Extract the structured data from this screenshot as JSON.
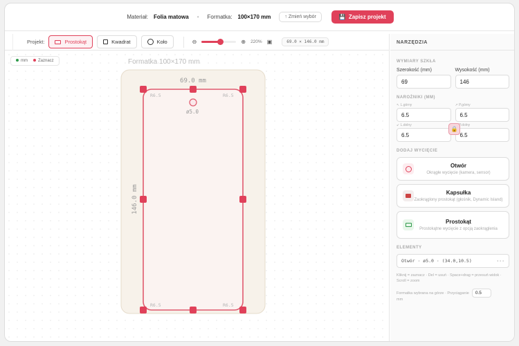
{
  "topbar": {
    "material_label": "Materiał:",
    "material_value": "Folia matowa",
    "format_label": "Formatka:",
    "format_value": "100×170 mm",
    "change_button": "↑ Zmień wybór",
    "save_button": "Zapisz projekt"
  },
  "toolbar": {
    "project_label": "Projekt:",
    "shapes": [
      {
        "label": "Prostokąt",
        "active": true
      },
      {
        "label": "Kwadrat",
        "active": false
      },
      {
        "label": "Koło",
        "active": false
      }
    ],
    "zoom_value": "220%",
    "zoom_level": 0.55,
    "dims_readout": "69.0 × 146.0 mm"
  },
  "legend": {
    "mm": "mm",
    "select": "Zaznacz"
  },
  "canvas": {
    "format_title": "Formatka 100×170 mm",
    "width_label": "69.0 mm",
    "height_label": "146.0 mm",
    "hole_label": "ø5.0",
    "corner_labels": [
      "R6.5",
      "R6.5",
      "R6.5",
      "R6.5"
    ],
    "accent": "#e0415a"
  },
  "panel": {
    "title": "NARZĘDZIA",
    "dims_section": "WYMIARY SZKŁA",
    "width_label": "Szerokość (mm)",
    "width_value": "69",
    "height_label": "Wysokość (mm)",
    "height_value": "146",
    "corners_section": "NAROŻNIKI (MM)",
    "corner_tl_label": "↖ L.górny",
    "corner_tl": "6.5",
    "corner_tr_label": "↗ P.górny",
    "corner_tr": "6.5",
    "corner_bl_label": "↙ L.dolny",
    "corner_bl": "6.5",
    "corner_br_label": "↘ P.dolny",
    "corner_br": "6.5",
    "cutout_section": "DODAJ WYCIĘCIE",
    "cutouts": [
      {
        "title": "Otwór",
        "sub": "Okrągłe wycięcie (kamera, sensor)"
      },
      {
        "title": "Kapsułka",
        "sub": "Zaokrąglony prostokąt (głośnik, Dynamic Island)"
      },
      {
        "title": "Prostokąt",
        "sub": "Prostokątne wycięcie z opcją zaokrąglenia"
      }
    ],
    "elements_section": "ELEMENTY",
    "element_selected": "Otwór · ø5.0 · (34.0,10.5)",
    "hint": "Kliknij = zaznacz · Del = usuń · Space+drag = przesuń widok · Scroll = zoom",
    "footer_text": "Formatka wybrana na górze · Przyciąganie",
    "snap_value": "0.5",
    "snap_unit": "mm"
  }
}
